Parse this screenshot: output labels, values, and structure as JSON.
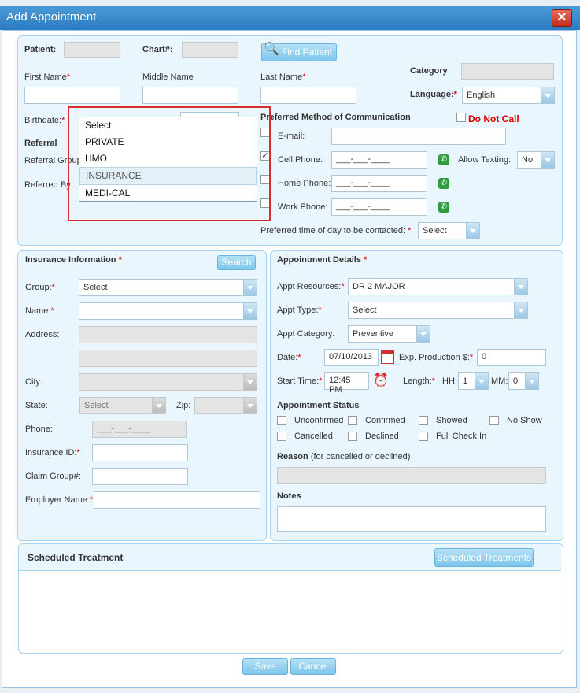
{
  "dialog": {
    "title": "Add Appointment"
  },
  "patient": {
    "patient_label": "Patient:",
    "chart_label": "Chart#:",
    "find_button": "Find Patient",
    "category_label": "Category",
    "first_name_label": "First Name",
    "middle_name_label": "Middle Name",
    "last_name_label": "Last Name",
    "language_label": "Language:",
    "language_value": "English",
    "birthdate_label": "Birthdate:",
    "referral_heading": "Referral",
    "referral_group_label": "Referral Group",
    "referred_by_label": "Referred By:",
    "req_mark": "*"
  },
  "referral_dropdown": {
    "options": [
      "Select",
      "PRIVATE",
      "HMO",
      "INSURANCE",
      "MEDI-CAL"
    ],
    "highlighted": "INSURANCE"
  },
  "communication": {
    "heading": "Preferred Method of Communication",
    "do_not_call": "Do Not Call",
    "email_label": "E-mail:",
    "cell_label": "Cell Phone:",
    "home_label": "Home Phone:",
    "work_label": "Work Phone:",
    "phone_placeholder": "___-___-____",
    "allow_texting_label": "Allow Texting:",
    "allow_texting_value": "No",
    "preferred_time_label": "Preferred time of day to be contacted:",
    "preferred_time_value": "Select"
  },
  "insurance": {
    "heading": "Insurance Information",
    "search_button": "Search",
    "group_label": "Group:",
    "group_value": "Select",
    "name_label": "Name:",
    "address_label": "Address:",
    "city_label": "City:",
    "state_label": "State:",
    "state_value": "Select",
    "zip_label": "Zip:",
    "phone_label": "Phone:",
    "phone_value": "___-___-____",
    "insurance_id_label": "Insurance ID:",
    "claim_group_label": "Claim Group#:",
    "employer_label": "Employer Name:"
  },
  "appointment": {
    "heading": "Appointment Details",
    "resources_label": "Appt Resources:",
    "resources_value": "DR 2 MAJOR",
    "type_label": "Appt Type:",
    "type_value": "Select",
    "category_label": "Appt Category:",
    "category_value": "Preventive",
    "date_label": "Date:",
    "date_value": "07/10/2013",
    "exp_label": "Exp. Production $:",
    "exp_value": "0",
    "start_label": "Start Time:",
    "start_value": "12:45 PM",
    "length_label": "Length:",
    "hh_label": "HH:",
    "hh_value": "1",
    "mm_label": "MM:",
    "mm_value": "0",
    "status_heading": "Appointment Status",
    "statuses": [
      "Unconfirmed",
      "Confirmed",
      "Showed",
      "No Show",
      "Cancelled",
      "Declined",
      "Full Check In"
    ],
    "reason_label": "Reason",
    "reason_note": "(for cancelled or declined)",
    "notes_label": "Notes"
  },
  "scheduled": {
    "heading": "Scheduled Treatment",
    "button": "Scheduled Treatments"
  },
  "footer": {
    "save": "Save",
    "cancel": "Cancel"
  }
}
